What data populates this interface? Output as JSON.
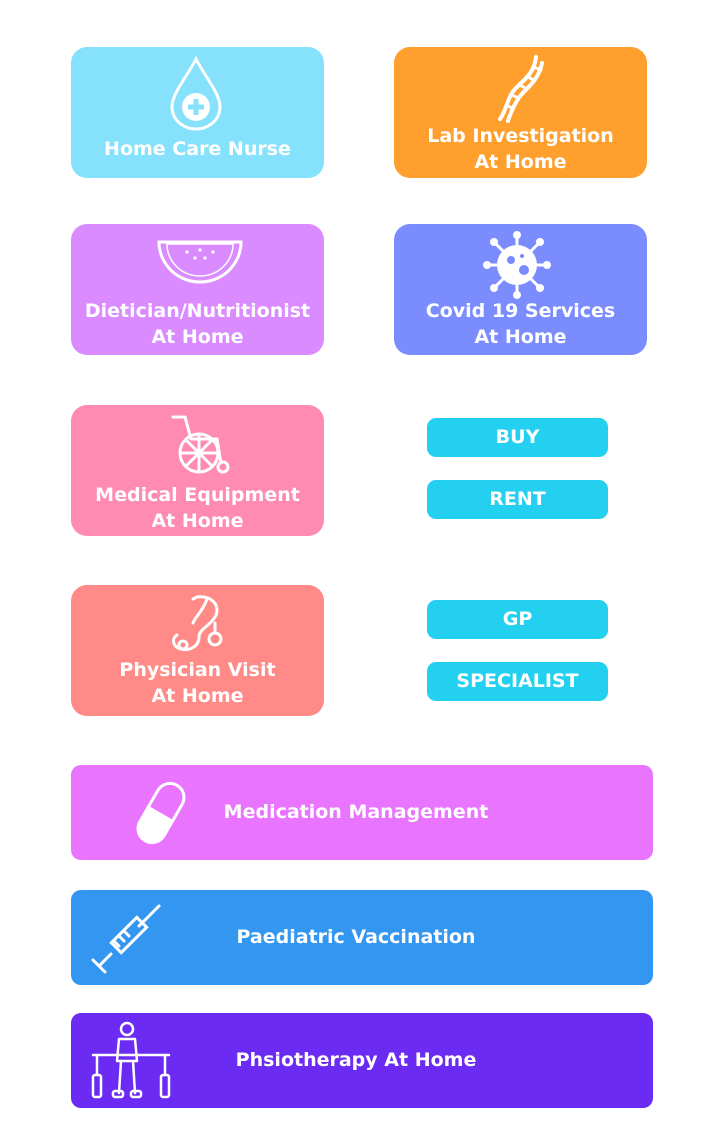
{
  "colors": {
    "nurse": "#85e1fc",
    "lab": "#ff9f2e",
    "diet": "#d98bff",
    "covid": "#7b8cff",
    "equip": "#ff8ab2",
    "physician": "#ff8a87",
    "pill_btn": "#24d0f0",
    "medication": "#e874ff",
    "vaccination": "#3396f0",
    "physio": "#6c2bf3"
  },
  "cards": {
    "nurse": {
      "line1": "Home Care Nurse",
      "icon": "water-drop-plus-icon"
    },
    "lab": {
      "line1": "Lab Investigation",
      "line2": "At Home",
      "icon": "dna-icon"
    },
    "diet": {
      "line1": "Dietician/Nutritionist",
      "line2": "At Home",
      "icon": "watermelon-icon"
    },
    "covid": {
      "line1": "Covid 19 Services",
      "line2": "At Home",
      "icon": "virus-icon"
    },
    "equip": {
      "line1": "Medical Equipment",
      "line2": "At Home",
      "icon": "wheelchair-icon"
    },
    "physician": {
      "line1": "Physician Visit",
      "line2": "At Home",
      "icon": "stethoscope-icon"
    }
  },
  "buttons": {
    "buy": "BUY",
    "rent": "RENT",
    "gp": "GP",
    "specialist": "SPECIALIST"
  },
  "wide": {
    "medication": {
      "label": "Medication Management",
      "icon": "capsule-icon"
    },
    "vaccination": {
      "label": "Paediatric Vaccination",
      "icon": "syringe-icon"
    },
    "physio": {
      "label": "Phsiotherapy At Home",
      "icon": "physiotherapy-icon"
    }
  }
}
